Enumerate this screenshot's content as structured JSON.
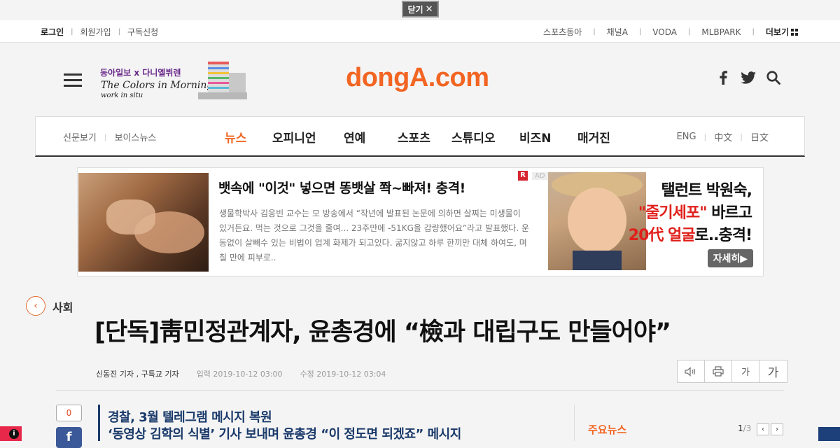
{
  "top_close": {
    "label": "닫기",
    "icon": "close-icon"
  },
  "utility": {
    "left": [
      "로그인",
      "회원가입",
      "구독신청"
    ],
    "right": [
      "스포츠동아",
      "채널A",
      "VODA",
      "MLBPARK"
    ],
    "more": "더보기"
  },
  "header": {
    "promo_line1": "동아일보 x 다니엘뷔렌",
    "promo_line2": "The Colors in Morning Calm",
    "promo_line3": "work in situ",
    "logo": "dongA.com",
    "icons": [
      "facebook-icon",
      "twitter-icon",
      "search-icon"
    ]
  },
  "nav": {
    "left": [
      "신문보기",
      "보이스뉴스"
    ],
    "main": [
      "뉴스",
      "오피니언",
      "연예",
      "스포츠",
      "스튜디오",
      "비즈N",
      "매거진"
    ],
    "right": [
      "ENG",
      "中文",
      "日文"
    ],
    "accent_color": "#f26522"
  },
  "ad": {
    "title": "뱃속에 \"이것\" 넣으면 똥뱃살 쫙~빠져! 충격!",
    "text": "생물학박사 김응빈 교수는 모 방송에서 “작년에 발표된 논문에 의하면 살찌는 미생물이 있거든요. 먹는 것으로 그것을 줄여... 23주만에 -51KG을 감량했어요”라고 발표했다. 운동없이 살빼수 있는 비법이 업계 화제가 되고있다. 굶지않고 하루 한끼만 대체 하여도, 며칠 만에 피부로..",
    "badge": "R",
    "label": "AD",
    "banner_line1": "탤런트 박원숙,",
    "banner_line2_red": "\"줄기세포\"",
    "banner_line2_rest": " 바르고",
    "banner_line3_red": "20代 얼굴",
    "banner_line3_rest": "로..충격!",
    "banner_button": "자세히▶"
  },
  "article": {
    "section": "사회",
    "headline": "[단독]靑민정관계자, 윤총경에 “檢과 대립구도 만들어야”",
    "reporters": "신동진 기자 , 구특교 기자",
    "input_date": "입력 2019-10-12 03:00",
    "modified_date": "수정 2019-10-12 03:04",
    "tools": [
      "speaker-icon",
      "print-icon",
      "가",
      "가"
    ],
    "share_count": "0",
    "subhead1": "경찰, 3월 텔레그램 메시지 복원",
    "subhead2": "‘동영상 김학의 식별’ 기사 보내며 윤총경 “이 정도면 되겠죠” 메시지"
  },
  "sidebar": {
    "title": "주요뉴스",
    "page_current": "1",
    "page_total": "/3"
  }
}
